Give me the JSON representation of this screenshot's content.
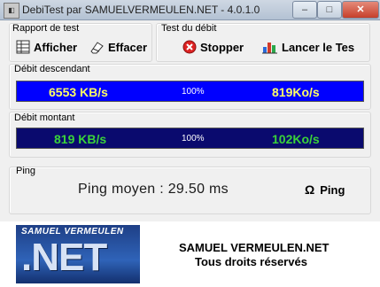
{
  "window": {
    "title": "DebiTest par SAMUELVERMEULEN.NET - 4.0.1.0",
    "minimize_glyph": "–",
    "maximize_glyph": "□",
    "close_glyph": "✕"
  },
  "rapport": {
    "label": "Rapport de test",
    "afficher_label": "Afficher",
    "effacer_label": "Effacer"
  },
  "test": {
    "label": "Test du débit",
    "stopper_label": "Stopper",
    "lancer_label": "Lancer le Tes"
  },
  "download": {
    "label": "Débit descendant",
    "speed_kbs": "6553 KB/s",
    "percent": "100%",
    "speed_kos": "819Ko/s",
    "progress": 1.0,
    "fill_color": "#0000ff",
    "text_color": "#ffff66"
  },
  "upload": {
    "label": "Débit montant",
    "speed_kbs": "819 KB/s",
    "percent": "100%",
    "speed_kos": "102Ko/s",
    "progress": 1.0,
    "fill_color": "#0a0a6e",
    "text_color": "#3ad33a"
  },
  "ping": {
    "label": "Ping",
    "result": "Ping moyen : 29.50 ms",
    "button_label": "Ping",
    "omega_glyph": "Ω"
  },
  "footer": {
    "logo_top": "SAMUEL VERMEULEN",
    "logo_main": ".NET",
    "line1": "SAMUEL VERMEULEN.NET",
    "line2": "Tous droits réservés"
  }
}
